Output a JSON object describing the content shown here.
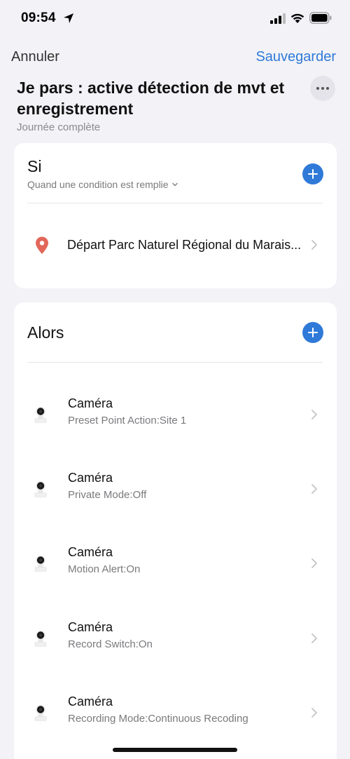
{
  "status_bar": {
    "time": "09:54"
  },
  "nav": {
    "cancel_label": "Annuler",
    "save_label": "Sauvegarder"
  },
  "header": {
    "title": "Je pars : active détection de mvt et enregistrement",
    "subtitle": "Journée complète"
  },
  "if_section": {
    "title": "Si",
    "condition_mode": "Quand une condition est remplie",
    "conditions": [
      {
        "icon": "location-pin-icon",
        "label": "Départ Parc Naturel Régional du Marais..."
      }
    ]
  },
  "then_section": {
    "title": "Alors",
    "actions": [
      {
        "icon": "camera-icon",
        "title": "Caméra",
        "detail": "Preset Point Action:Site 1"
      },
      {
        "icon": "camera-icon",
        "title": "Caméra",
        "detail": "Private Mode:Off"
      },
      {
        "icon": "camera-icon",
        "title": "Caméra",
        "detail": "Motion Alert:On"
      },
      {
        "icon": "camera-icon",
        "title": "Caméra",
        "detail": "Record Switch:On"
      },
      {
        "icon": "camera-icon",
        "title": "Caméra",
        "detail": "Recording Mode:Continuous Recoding"
      }
    ]
  },
  "colors": {
    "accent": "#2f7ad8",
    "background": "#f2f2f7",
    "pin": "#e2665a"
  }
}
